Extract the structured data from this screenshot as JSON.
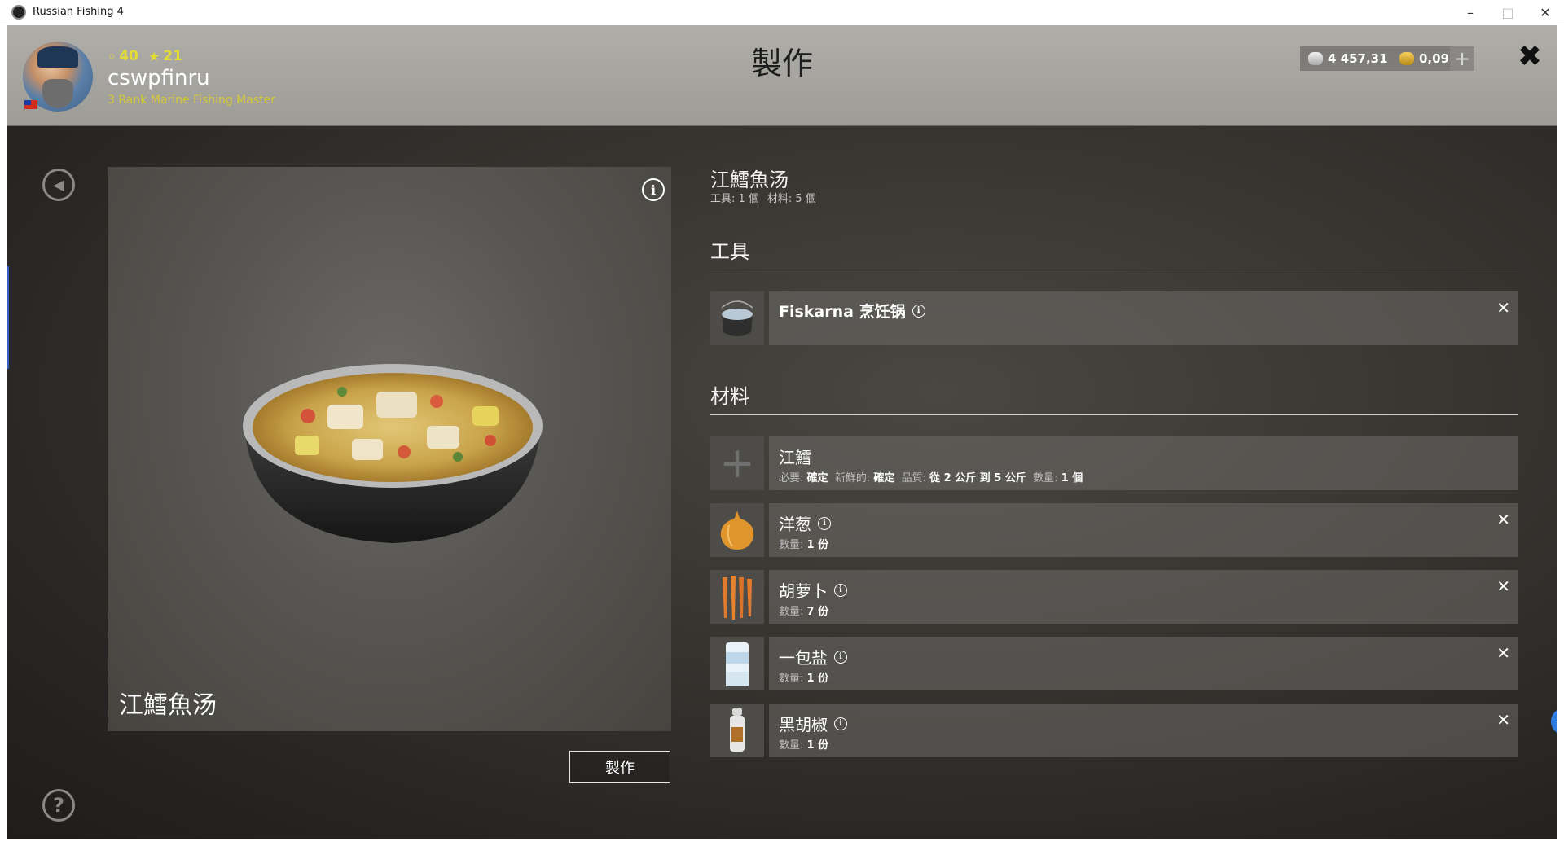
{
  "window": {
    "title": "Russian Fishing 4"
  },
  "header": {
    "level": "40",
    "stars": "21",
    "username": "cswpfinru",
    "rank": "3 Rank Marine Fishing Master",
    "title": "製作",
    "silver": "4 457,31",
    "gold": "0,09",
    "plus": "+"
  },
  "preview": {
    "dish_name": "江鱈魚汤",
    "info": "i"
  },
  "craft_button": "製作",
  "recipe": {
    "title": "江鱈魚汤",
    "tools_count": "工具: 1 個",
    "materials_count": "材料: 5 個"
  },
  "sections": {
    "tools": "工具",
    "materials": "材料"
  },
  "tools": [
    {
      "name": "Fiskarna 烹饪锅",
      "icon": "pot-icon"
    }
  ],
  "materials": [
    {
      "name": "江鱈",
      "required_label": "必要:",
      "required": "確定",
      "fresh_label": "新鮮的:",
      "fresh": "確定",
      "quality_label": "品質:",
      "quality": "從 2 公斤 到 5 公斤",
      "qty_label": "數量:",
      "qty": "1 個"
    },
    {
      "name": "洋葱",
      "qty_label": "數量:",
      "qty": "1 份",
      "icon": "onion-icon"
    },
    {
      "name": "胡萝卜",
      "qty_label": "數量:",
      "qty": "7 份",
      "icon": "carrot-icon"
    },
    {
      "name": "一包盐",
      "qty_label": "數量:",
      "qty": "1 份",
      "icon": "salt-icon"
    },
    {
      "name": "黑胡椒",
      "qty_label": "數量:",
      "qty": "1 份",
      "icon": "pepper-icon"
    }
  ],
  "colors": {
    "stat_yellow": "#e3dd35",
    "rank_yellow": "#d4c93a",
    "accent_blue": "#2f7de1"
  }
}
